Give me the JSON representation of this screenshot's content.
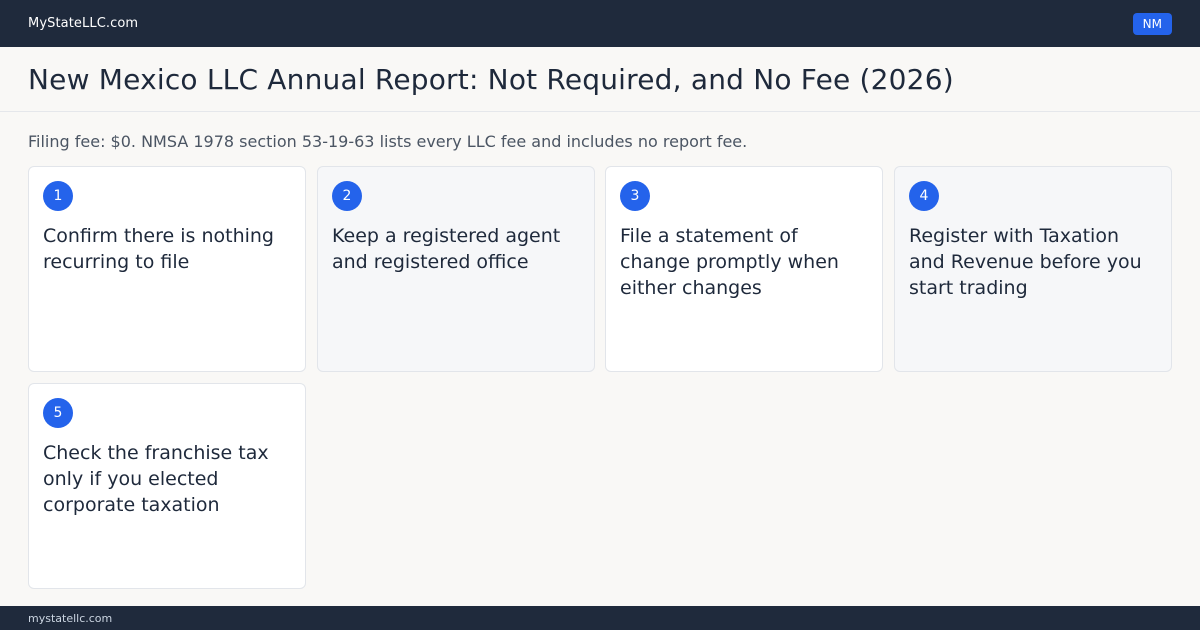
{
  "topbar": {
    "brand": "MyStateLLC.com",
    "state_badge": "NM"
  },
  "header": {
    "title": "New Mexico LLC Annual Report: Not Required, and No Fee (2026)"
  },
  "summary": {
    "fee_line": "Filing fee: $0. NMSA 1978 section 53-19-63 lists every LLC fee and includes no report fee."
  },
  "steps": [
    {
      "number": "1",
      "title": "Confirm there is nothing recurring to file"
    },
    {
      "number": "2",
      "title": "Keep a registered agent and registered office"
    },
    {
      "number": "3",
      "title": "File a statement of change promptly when either changes"
    },
    {
      "number": "4",
      "title": "Register with Taxation and Revenue before you start trading"
    },
    {
      "number": "5",
      "title": "Check the franchise tax only if you elected corporate taxation"
    }
  ],
  "footer": {
    "url": "mystatellc.com"
  },
  "colors": {
    "topbar": "#1f2a3c",
    "accent": "#2463eb",
    "page_bg": "#f9f8f6"
  }
}
